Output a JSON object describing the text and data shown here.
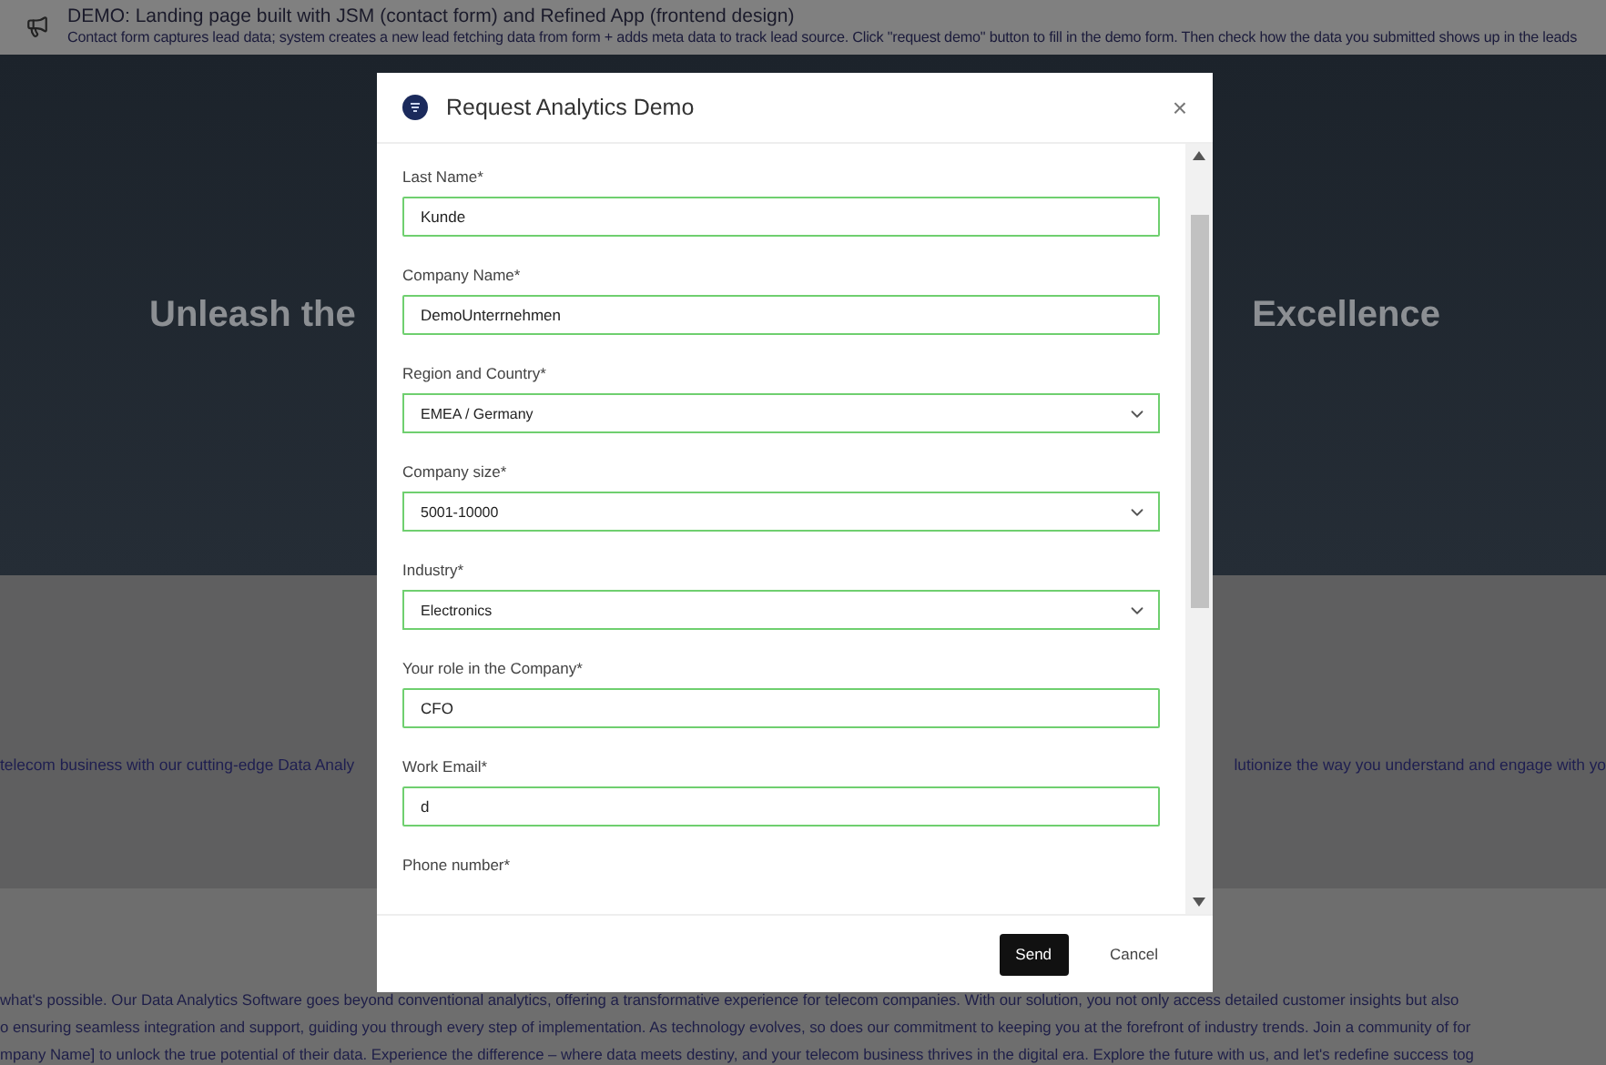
{
  "banner": {
    "title": "DEMO: Landing page built with JSM (contact form) and Refined App (frontend design)",
    "text": "Contact form captures lead data; system creates a new lead fetching data from form + adds meta data to track lead source. Click \"request demo\" button to fill in the demo form. Then check how the data you submitted shows up in the leads"
  },
  "hero": {
    "heading_left": "Unleash the",
    "heading_right": "Excellence",
    "line_left": "telecom business with our cutting-edge Data Analy",
    "line_right": "lutionize the way you understand and engage with yo"
  },
  "body_text": [
    "what's possible. Our Data Analytics Software goes beyond conventional analytics, offering a transformative experience for telecom companies. With our solution, you not only access detailed customer insights but also",
    "o ensuring seamless integration and support, guiding you through every step of implementation. As technology evolves, so does our commitment to keeping you at the forefront of industry trends. Join a community of for",
    "mpany Name] to unlock the true potential of their data. Experience the difference – where data meets destiny, and your telecom business thrives in the digital era. Explore the future with us, and let's redefine success tog"
  ],
  "dialog": {
    "title": "Request Analytics Demo",
    "close": "×",
    "fields": [
      {
        "kind": "text",
        "label": "Last Name*",
        "value": "Kunde"
      },
      {
        "kind": "text",
        "label": "Company Name*",
        "value": "DemoUnterrnehmen"
      },
      {
        "kind": "select",
        "label": "Region and Country*",
        "value": "EMEA / Germany"
      },
      {
        "kind": "select",
        "label": "Company size*",
        "value": "5001-10000"
      },
      {
        "kind": "select",
        "label": "Industry*",
        "value": "Electronics"
      },
      {
        "kind": "text",
        "label": "Your role in the Company*",
        "value": "CFO"
      },
      {
        "kind": "text",
        "label": "Work Email*",
        "value": "d"
      },
      {
        "kind": "label",
        "label": "Phone number*"
      }
    ],
    "buttons": [
      {
        "kind": "primary",
        "label": "Send"
      },
      {
        "kind": "plain",
        "label": "Cancel"
      }
    ]
  }
}
